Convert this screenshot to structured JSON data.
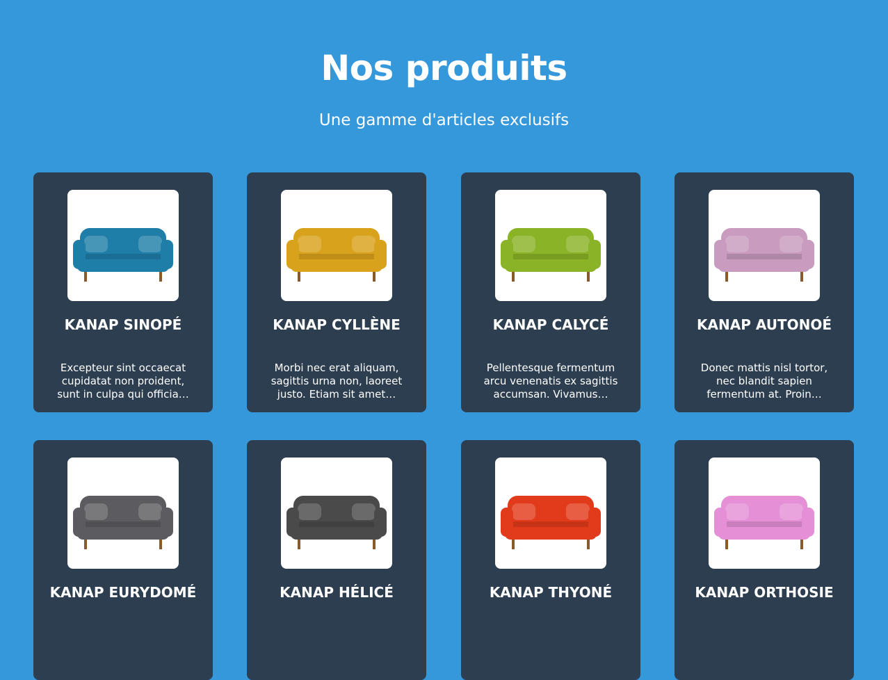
{
  "header": {
    "title": "Nos produits",
    "subtitle": "Une gamme d'articles exclusifs"
  },
  "colors": {
    "background": "#3498db",
    "card": "#2c3e50",
    "text": "#ffffff"
  },
  "products": [
    {
      "name": "KANAP SINOPÉ",
      "description": "Excepteur sint occaecat cupidatat non proident, sunt in culpa qui officia…",
      "image": "blue-sofa-icon",
      "color": "#1f7ea8"
    },
    {
      "name": "KANAP CYLLÈNE",
      "description": "Morbi nec erat aliquam, sagittis urna non, laoreet justo. Etiam sit amet…",
      "image": "yellow-sofa-icon",
      "color": "#d9a21c"
    },
    {
      "name": "KANAP CALYCÉ",
      "description": "Pellentesque fermentum arcu venenatis ex sagittis accumsan. Vivamus…",
      "image": "green-sofa-icon",
      "color": "#8ab327"
    },
    {
      "name": "KANAP AUTONOÉ",
      "description": "Donec mattis nisl tortor, nec blandit sapien fermentum at. Proin…",
      "image": "pink-sofa-icon",
      "color": "#c99bbf"
    },
    {
      "name": "KANAP EURYDOMÉ",
      "description": "",
      "image": "gray-sofa-icon",
      "color": "#5c5c60"
    },
    {
      "name": "KANAP HÉLICÉ",
      "description": "",
      "image": "dark-gray-sofa-icon",
      "color": "#4a4a4a"
    },
    {
      "name": "KANAP THYONÉ",
      "description": "",
      "image": "red-sofa-icon",
      "color": "#e23b1b"
    },
    {
      "name": "KANAP ORTHOSIE",
      "description": "",
      "image": "pink-tufted-sofa-icon",
      "color": "#e48fd6"
    }
  ]
}
